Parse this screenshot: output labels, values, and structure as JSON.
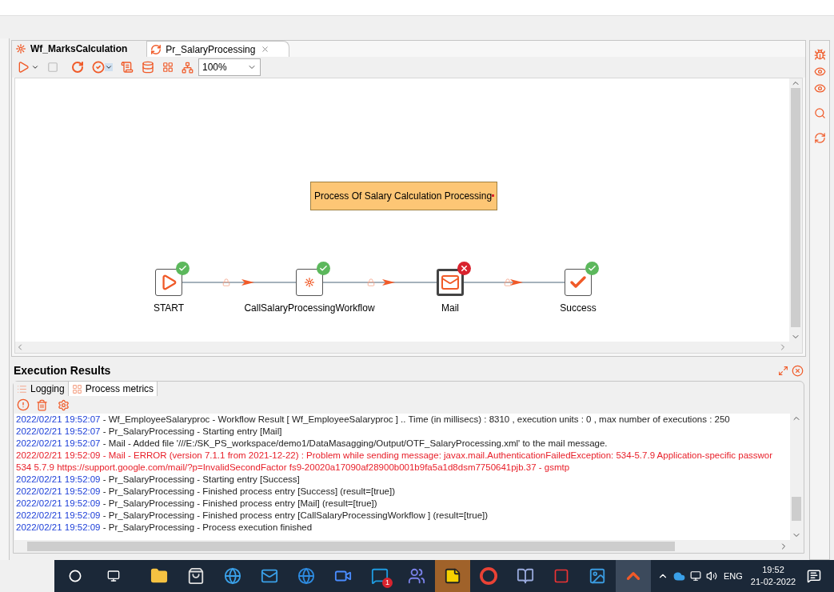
{
  "editor_tabs": [
    {
      "label": "Wf_MarksCalculation",
      "kind": "workflow",
      "selected": false
    },
    {
      "label": "Pr_SalaryProcessing",
      "kind": "process",
      "selected": true
    }
  ],
  "zoom": {
    "value": "100%"
  },
  "note": {
    "text": "Process Of Salary Calculation Processing"
  },
  "nodes": [
    {
      "label": "START",
      "kind": "start",
      "failed": false,
      "selected": false
    },
    {
      "label": "CallSalaryProcessingWorkflow",
      "kind": "workflow",
      "failed": false,
      "selected": false
    },
    {
      "label": "Mail",
      "kind": "mail",
      "failed": true,
      "selected": true
    },
    {
      "label": "Success",
      "kind": "success",
      "failed": false,
      "selected": false
    }
  ],
  "results": {
    "title": "Execution Results",
    "tabs": [
      {
        "label": "Logging",
        "selected": true
      },
      {
        "label": "Process metrics",
        "selected": false
      }
    ],
    "log": [
      {
        "time": "2022/02/21 19:52:07",
        "message": " - Wf_EmployeeSalaryproc - Workflow Result [ Wf_EmployeeSalaryproc ] .. Time (in millisecs) : 8310 , execution units : 0 , max number of executions : 250",
        "error": false
      },
      {
        "time": "2022/02/21 19:52:07",
        "message": " - Pr_SalaryProcessing - Starting entry [Mail]",
        "error": false
      },
      {
        "time": "2022/02/21 19:52:07",
        "message": " - Mail - Added file '///E:/SK_PS_workspace/demo1/DataMasagging/Output/OTF_SalaryProcessing.xml' to the mail message.",
        "error": false
      },
      {
        "time": "2022/02/21 19:52:09",
        "message": " - Mail - ERROR (version 7.1.1 from 2021-12-22) : Problem while sending message: javax.mail.AuthenticationFailedException: 534-5.7.9 Application-specific passwor",
        "error": true
      },
      {
        "message": "534 5.7.9  https://support.google.com/mail/?p=InvalidSecondFactor fs9-20020a17090af28900b001b9fa5a1d8dsm7750641pjb.37 - gsmtp",
        "error": true
      },
      {
        "time": "2022/02/21 19:52:09",
        "message": " - Pr_SalaryProcessing - Starting entry [Success]",
        "error": false
      },
      {
        "time": "2022/02/21 19:52:09",
        "message": " - Pr_SalaryProcessing - Finished process entry [Success] (result=[true])",
        "error": false
      },
      {
        "time": "2022/02/21 19:52:09",
        "message": " - Pr_SalaryProcessing - Finished process entry [Mail] (result=[true])",
        "error": false
      },
      {
        "time": "2022/02/21 19:52:09",
        "message": " - Pr_SalaryProcessing - Finished process entry [CallSalaryProcessingWorkflow ] (result=[true])",
        "error": false
      },
      {
        "time": "2022/02/21 19:52:09",
        "message": " - Pr_SalaryProcessing - Process execution finished",
        "error": false
      }
    ]
  },
  "taskbar": {
    "skype_badge": "1",
    "language": "ENG",
    "time": "19:52",
    "date": "21-02-2022"
  }
}
